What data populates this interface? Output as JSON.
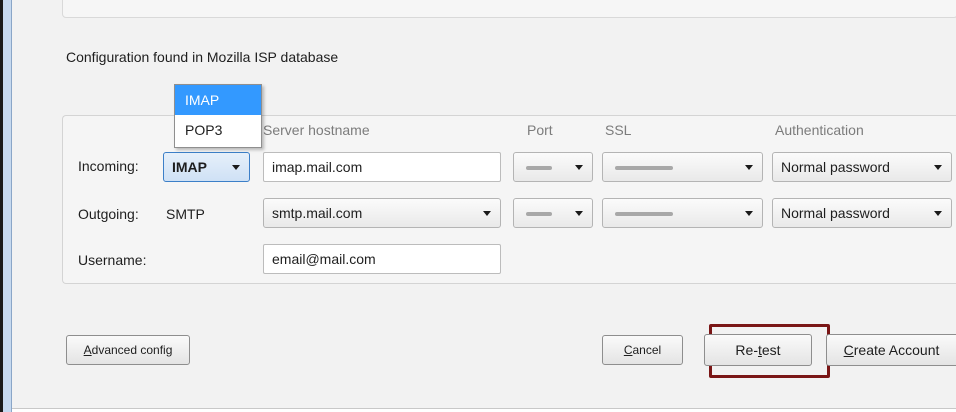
{
  "config_found": "Configuration found in Mozilla ISP database",
  "columns": {
    "server_hostname": "Server hostname",
    "port": "Port",
    "ssl": "SSL",
    "authentication": "Authentication"
  },
  "protocol_dropdown": {
    "options": [
      "IMAP",
      "POP3"
    ],
    "highlighted": "IMAP"
  },
  "incoming": {
    "label": "Incoming:",
    "protocol": "IMAP",
    "hostname": "imap.mail.com",
    "authentication": "Normal password"
  },
  "outgoing": {
    "label": "Outgoing:",
    "protocol": "SMTP",
    "hostname": "smtp.mail.com",
    "authentication": "Normal password"
  },
  "username": {
    "label": "Username:",
    "value": "email@mail.com"
  },
  "buttons": {
    "advanced_config": {
      "prefix": "",
      "accel": "A",
      "suffix": "dvanced config"
    },
    "cancel": {
      "prefix": "",
      "accel": "C",
      "suffix": "ancel"
    },
    "retest": {
      "prefix": "Re-",
      "accel": "t",
      "suffix": "est"
    },
    "create_account": {
      "prefix": "",
      "accel": "C",
      "suffix": "reate Account"
    }
  },
  "colors": {
    "selection": "#3399ff",
    "highlight_outline": "#7a1616",
    "focus_border": "#3c7fc8"
  }
}
